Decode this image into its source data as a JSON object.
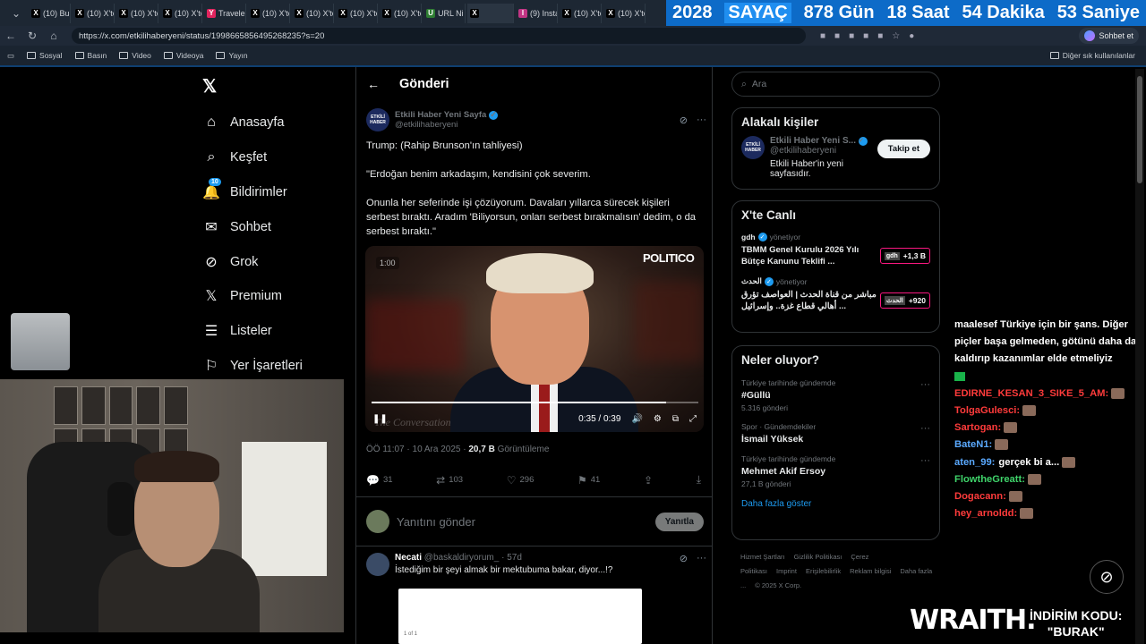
{
  "browser": {
    "tabs": [
      {
        "icon": "X",
        "label": "(10) Bu"
      },
      {
        "icon": "X",
        "label": "(10) X'te"
      },
      {
        "icon": "X",
        "label": "(10) X'te"
      },
      {
        "icon": "X",
        "label": "(10) X'te"
      },
      {
        "icon": "Y",
        "label": "Travele"
      },
      {
        "icon": "X",
        "label": "(10) X'te"
      },
      {
        "icon": "X",
        "label": "(10) X'te"
      },
      {
        "icon": "X",
        "label": "(10) X'te"
      },
      {
        "icon": "X",
        "label": "(10) X'te"
      },
      {
        "icon": "U",
        "label": "URL Ni"
      },
      {
        "icon": "X",
        "label": ""
      },
      {
        "icon": "I",
        "label": "(9) Insta"
      },
      {
        "icon": "X",
        "label": "(10) X'te"
      },
      {
        "icon": "X",
        "label": "(10) X'te"
      }
    ],
    "url": "https://x.com/etkilihaberyeni/status/1998665856495268235?s=20",
    "chat_button": "Sohbet et",
    "bookmarks": [
      "Sosyal",
      "Basın",
      "Video",
      "Videoya",
      "Yayın"
    ],
    "other_bookmarks": "Diğer sık kullanılanlar"
  },
  "counter": {
    "year": "2028",
    "label": "SAYAÇ",
    "days": "878 Gün",
    "hours": "18 Saat",
    "minutes": "54 Dakika",
    "seconds": "53 Saniye"
  },
  "nav": {
    "items": [
      {
        "icon": "home-icon",
        "label": "Anasayfa"
      },
      {
        "icon": "search-icon",
        "label": "Keşfet"
      },
      {
        "icon": "bell-icon",
        "label": "Bildirimler",
        "badge": "10"
      },
      {
        "icon": "mail-icon",
        "label": "Sohbet"
      },
      {
        "icon": "grok-icon",
        "label": "Grok"
      },
      {
        "icon": "x-icon",
        "label": "Premium"
      },
      {
        "icon": "list-icon",
        "label": "Listeler"
      },
      {
        "icon": "bookmark-icon",
        "label": "Yer İşaretleri"
      }
    ]
  },
  "post": {
    "header": "Gönderi",
    "author_name": "Etkili Haber Yeni Sayfa",
    "author_handle": "@etkilihaberyeni",
    "avatar_text": "ETKİLİ HABER",
    "text": [
      "Trump: (Rahip Brunson'ın tahliyesi)",
      "\"Erdoğan benim arkadaşım, kendisini çok severim.",
      "Onunla her seferinde işi çözüyorum. Davaları yıllarca sürecek kişileri serbest bıraktı. Aradım 'Biliyorsun, onları serbest bırakmalısın' dedim, o da serbest bıraktı.\""
    ],
    "video": {
      "badge": "1:00",
      "logo": "POLITICO",
      "time": "0:35 / 0:39",
      "progress": 0.9,
      "watermark": "The Conversation"
    },
    "time": "ÖÖ 11:07 · 10 Ara 2025 · ",
    "views": "20,7 B",
    "views_label": " Görüntüleme",
    "stats": {
      "replies": "31",
      "reposts": "103",
      "likes": "296",
      "bookmarks": "41"
    },
    "reply_placeholder": "Yanıtını gönder",
    "reply_button": "Yanıtla"
  },
  "reply": {
    "name": "Necati",
    "handle": "@baskaldiryorum_ · 57d",
    "text": "İstediğim bir şeyi almak bir mektubuma bakar, diyor...!?",
    "image_caption": "1 of 1"
  },
  "sidebar": {
    "search_placeholder": "Ara",
    "related": {
      "title": "Alakalı kişiler",
      "name": "Etkili Haber Yeni S...",
      "handle": "@etkilihaberyeni",
      "bio": "Etkili Haber'in yeni sayfasıdır.",
      "follow": "Takip et"
    },
    "live": {
      "title": "X'te Canlı",
      "items": [
        {
          "source": "gdh",
          "role": "yönetiyor",
          "title": "TBMM Genel Kurulu 2026 Yılı Bütçe Kanunu Teklifi ...",
          "pill_tag": "gdh",
          "count": "+1,3 B"
        },
        {
          "source": "الحدث",
          "role": "yönetiyor",
          "title": "مباشر من قناة الحدث | العواصف تؤرق أهالي قطاع غزة.. وإسرائيل ...",
          "pill_tag": "الحدث",
          "count": "+920"
        }
      ]
    },
    "trends": {
      "title": "Neler oluyor?",
      "items": [
        {
          "context": "Türkiye tarihinde gündemde",
          "name": "#Güllü",
          "posts": "5.316 gönderi"
        },
        {
          "context": "Spor · Gündemdekiler",
          "name": "İsmail Yüksek",
          "posts": ""
        },
        {
          "context": "Türkiye tarihinde gündemde",
          "name": "Mehmet Akif Ersoy",
          "posts": "27,1 B gönderi"
        }
      ],
      "more": "Daha fazla göster"
    },
    "footer": [
      "Hizmet Şartları",
      "Gizlilik Politikası",
      "Çerez Politikası",
      "Imprint",
      "Erişilebilirlik",
      "Reklam bilgisi",
      "Daha fazla ...",
      "© 2025 X Corp."
    ]
  },
  "chat": [
    {
      "user": "",
      "text": "maalesef Türkiye için bir şans. Diğer piçler başa gelmeden, götünü daha da kaldırıp kazanımlar elde etmeliyiz"
    },
    {
      "user": "EDIRNE_KESAN_3_SIKE_5_AM:",
      "text": ""
    },
    {
      "user": "TolgaGulesci:",
      "text": ""
    },
    {
      "user": "Sartogan:",
      "text": ""
    },
    {
      "user": "BateN1:",
      "text": ""
    },
    {
      "user": "aten_99:",
      "text": "gerçek bi a..."
    },
    {
      "user": "FlowtheGreatt:",
      "text": ""
    },
    {
      "user": "Dogacann:",
      "text": ""
    },
    {
      "user": "hey_arnoldd:",
      "text": ""
    }
  ],
  "promo": {
    "brand": "WRAITH.",
    "code_label": "İNDİRİM KODU:",
    "code": "\"BURAK\""
  }
}
